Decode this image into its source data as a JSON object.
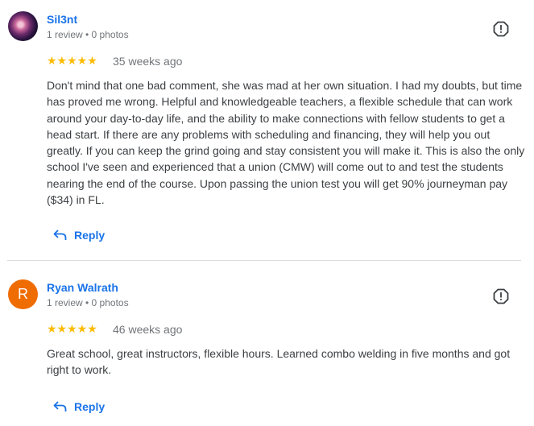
{
  "reviews": [
    {
      "reviewer": "Sil3nt",
      "avatar_letter": "",
      "meta": "1 review • 0 photos",
      "stars": "★★★★★",
      "rating": 5,
      "time": "35 weeks ago",
      "text": "Don't mind that one bad comment, she was mad at her own situation. I had my doubts, but time has proved me wrong. Helpful and knowledgeable teachers, a flexible schedule that can work around your day-to-day life, and the ability to make connections with fellow students to get a head start. If there are any problems with scheduling and financing, they will help you out greatly. If you can keep the grind going and stay consistent you will make it. This is also the only school I've seen and experienced that a union (CMW) will come out to and test the students nearing the end of the course. Upon passing the union test you will get 90% journeyman pay ($34) in FL.",
      "reply_label": "Reply"
    },
    {
      "reviewer": "Ryan Walrath",
      "avatar_letter": "R",
      "meta": "1 review • 0 photos",
      "stars": "★★★★★",
      "rating": 5,
      "time": "46 weeks ago",
      "text": "Great school, great instructors, flexible hours. Learned combo welding in five months and got right to work.",
      "reply_label": "Reply"
    }
  ],
  "colors": {
    "link": "#1a73e8",
    "star": "#fbbc04",
    "avatar_orange": "#ef6c00"
  },
  "icons": {
    "flag": "report-flag-icon",
    "reply": "reply-arrow-icon"
  }
}
